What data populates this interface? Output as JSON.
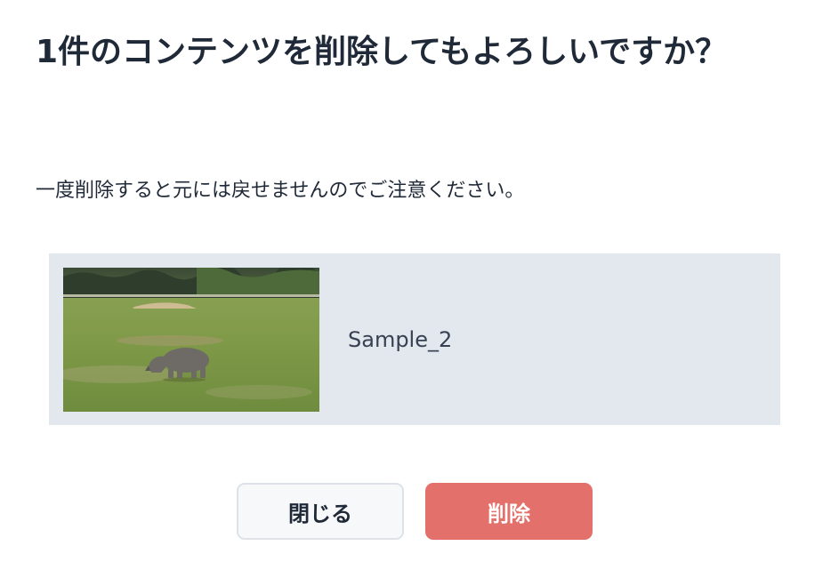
{
  "dialog": {
    "title": "1件のコンテンツを削除してもよろしいですか？",
    "description": "一度削除すると元には戻せませんのでご注意ください。",
    "content_item": {
      "name": "Sample_2",
      "thumbnail_icon": "rhino-photo-thumbnail"
    },
    "buttons": {
      "close_label": "閉じる",
      "delete_label": "削除"
    }
  },
  "colors": {
    "delete_button": "#e4706c",
    "close_button_bg": "#f7f8fa",
    "card_bg": "#e3e7ee",
    "text": "#1f2937"
  }
}
